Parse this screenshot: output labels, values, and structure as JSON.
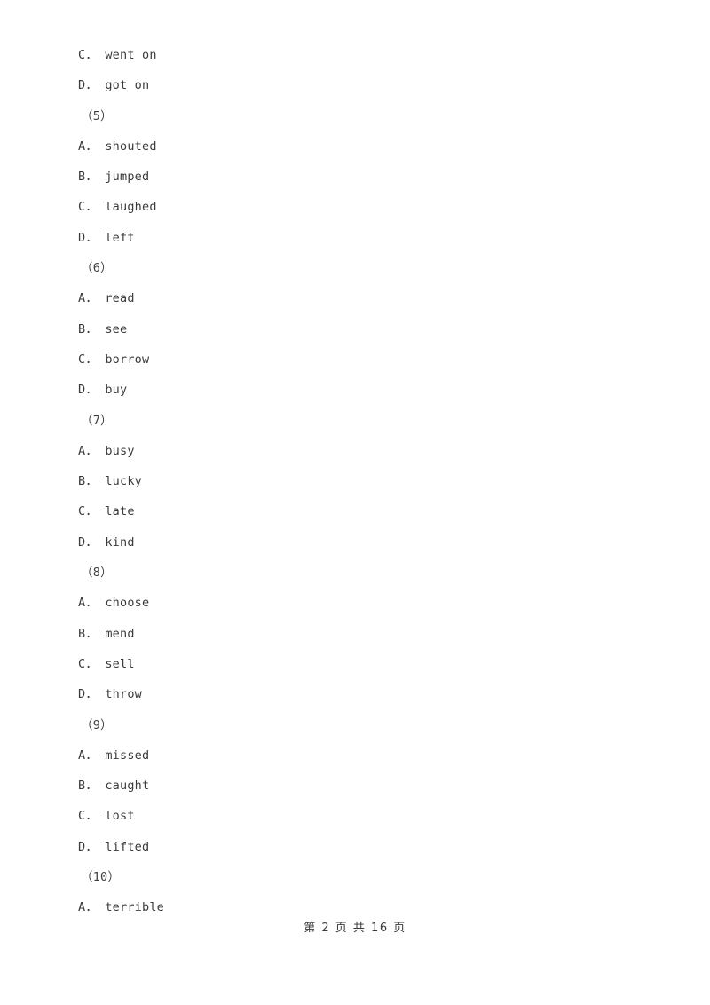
{
  "document": {
    "type": "exam-paper",
    "language": "en-with-zh-footer",
    "text_color": "#3a3a3a",
    "background_color": "#ffffff"
  },
  "body": {
    "lines": [
      {
        "kind": "option",
        "letter": "C",
        "separator": "．",
        "text": "went on"
      },
      {
        "kind": "option",
        "letter": "D",
        "separator": "．",
        "text": "got on"
      },
      {
        "kind": "question",
        "label": "（5）"
      },
      {
        "kind": "option",
        "letter": "A",
        "separator": "．",
        "text": "shouted"
      },
      {
        "kind": "option",
        "letter": "B",
        "separator": "．",
        "text": "jumped"
      },
      {
        "kind": "option",
        "letter": "C",
        "separator": "．",
        "text": "laughed"
      },
      {
        "kind": "option",
        "letter": "D",
        "separator": "．",
        "text": "left"
      },
      {
        "kind": "question",
        "label": "（6）"
      },
      {
        "kind": "option",
        "letter": "A",
        "separator": "．",
        "text": "read"
      },
      {
        "kind": "option",
        "letter": "B",
        "separator": "．",
        "text": "see"
      },
      {
        "kind": "option",
        "letter": "C",
        "separator": "．",
        "text": "borrow"
      },
      {
        "kind": "option",
        "letter": "D",
        "separator": "．",
        "text": "buy"
      },
      {
        "kind": "question",
        "label": "（7）"
      },
      {
        "kind": "option",
        "letter": "A",
        "separator": "．",
        "text": "busy"
      },
      {
        "kind": "option",
        "letter": "B",
        "separator": "．",
        "text": "lucky"
      },
      {
        "kind": "option",
        "letter": "C",
        "separator": "．",
        "text": "late"
      },
      {
        "kind": "option",
        "letter": "D",
        "separator": "．",
        "text": "kind"
      },
      {
        "kind": "question",
        "label": "（8）"
      },
      {
        "kind": "option",
        "letter": "A",
        "separator": "．",
        "text": "choose"
      },
      {
        "kind": "option",
        "letter": "B",
        "separator": "．",
        "text": "mend"
      },
      {
        "kind": "option",
        "letter": "C",
        "separator": "．",
        "text": "sell"
      },
      {
        "kind": "option",
        "letter": "D",
        "separator": "．",
        "text": "throw"
      },
      {
        "kind": "question",
        "label": "（9）"
      },
      {
        "kind": "option",
        "letter": "A",
        "separator": "．",
        "text": "missed"
      },
      {
        "kind": "option",
        "letter": "B",
        "separator": "．",
        "text": "caught"
      },
      {
        "kind": "option",
        "letter": "C",
        "separator": "．",
        "text": "lost"
      },
      {
        "kind": "option",
        "letter": "D",
        "separator": "．",
        "text": "lifted"
      },
      {
        "kind": "question",
        "label": "（10）"
      },
      {
        "kind": "option",
        "letter": "A",
        "separator": "．",
        "text": "terrible"
      }
    ]
  },
  "footer": {
    "text": "第 2 页 共 16 页",
    "current_page": "2",
    "total_pages": "16"
  }
}
